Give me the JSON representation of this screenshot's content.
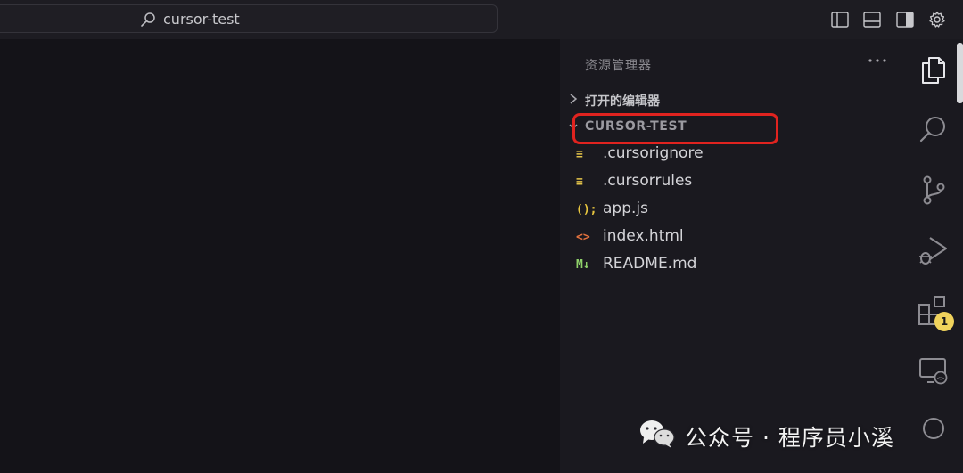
{
  "titlebar": {
    "search_text": "cursor-test"
  },
  "sidebar": {
    "title": "资源管理器",
    "more_label": "···",
    "open_editors_label": "打开的编辑器",
    "folder_label": "CURSOR-TEST",
    "files": [
      {
        "name": ".cursorignore",
        "icon": "lines-icon",
        "icon_text": "≡",
        "icon_color": "#e2c24a"
      },
      {
        "name": ".cursorrules",
        "icon": "lines-icon",
        "icon_text": "≡",
        "icon_color": "#e2c24a"
      },
      {
        "name": "app.js",
        "icon": "js-icon",
        "icon_text": "();",
        "icon_color": "#e8c63f"
      },
      {
        "name": "index.html",
        "icon": "html-icon",
        "icon_text": "<>",
        "icon_color": "#e6733e"
      },
      {
        "name": "README.md",
        "icon": "markdown-icon",
        "icon_text": "M↓",
        "icon_color": "#8fd16a"
      }
    ]
  },
  "activitybar": {
    "extensions_badge": "1"
  },
  "watermark": {
    "text": "公众号 · 程序员小溪"
  },
  "colors": {
    "accent_highlight": "#e0231f",
    "badge": "#f0d35c"
  }
}
